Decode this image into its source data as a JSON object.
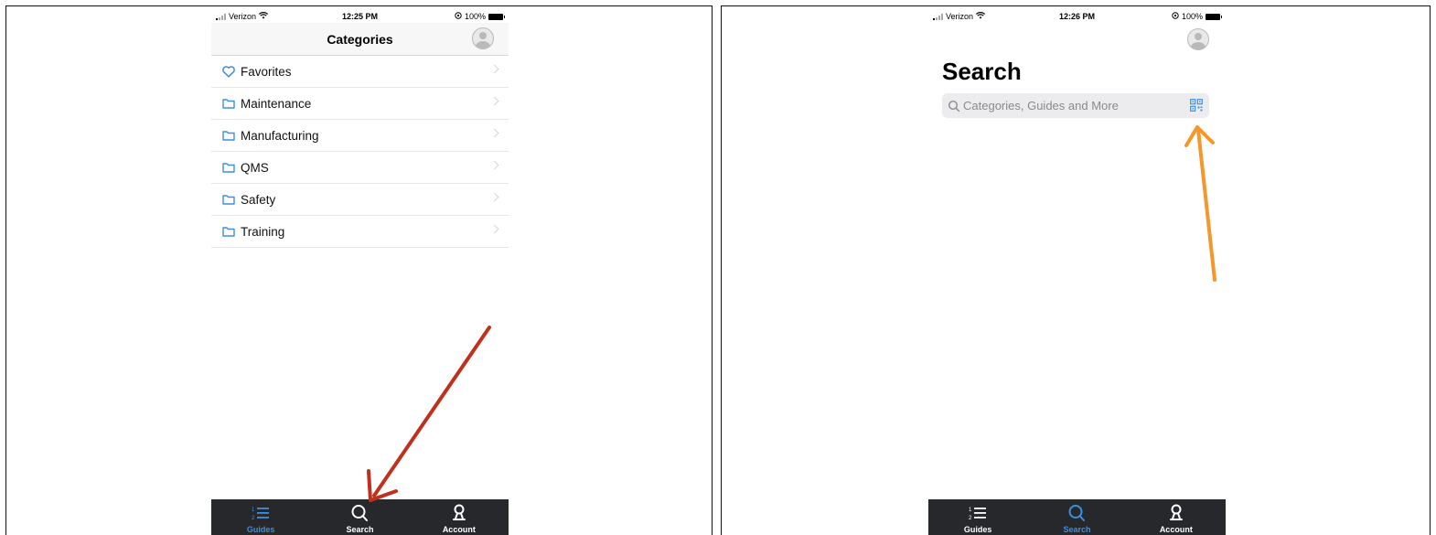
{
  "left_screen": {
    "status_bar": {
      "carrier": "Verizon",
      "time": "12:25 PM",
      "battery": "100%"
    },
    "header": {
      "title": "Categories"
    },
    "categories": [
      {
        "label": "Favorites",
        "icon": "heart-icon"
      },
      {
        "label": "Maintenance",
        "icon": "folder-icon"
      },
      {
        "label": "Manufacturing",
        "icon": "folder-icon"
      },
      {
        "label": "QMS",
        "icon": "folder-icon"
      },
      {
        "label": "Safety",
        "icon": "folder-icon"
      },
      {
        "label": "Training",
        "icon": "folder-icon"
      }
    ],
    "tab_bar": {
      "guides_label": "Guides",
      "search_label": "Search",
      "account_label": "Account",
      "active_tab": "Guides"
    }
  },
  "right_screen": {
    "status_bar": {
      "carrier": "Verizon",
      "time": "12:26 PM",
      "battery": "100%"
    },
    "search_title": "Search",
    "search_placeholder": "Categories, Guides and More",
    "tab_bar": {
      "guides_label": "Guides",
      "search_label": "Search",
      "account_label": "Account",
      "active_tab": "Search"
    }
  },
  "colors": {
    "accent_blue": "#3d8fe0",
    "tab_bar_bg": "#26282b",
    "annotation_red": "#c0311d",
    "annotation_orange": "#f5972a"
  }
}
